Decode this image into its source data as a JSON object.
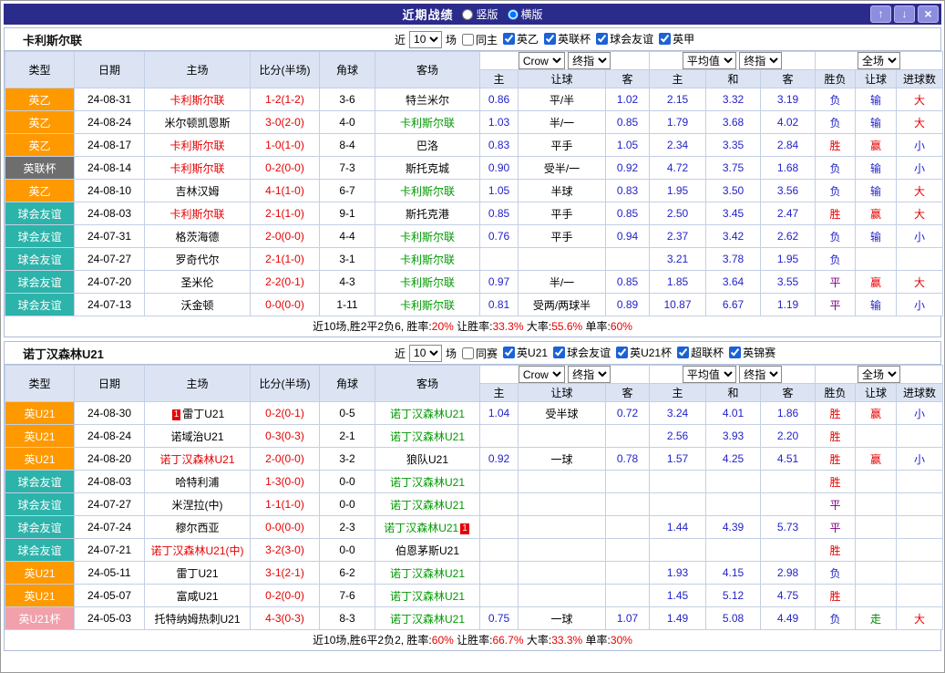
{
  "titlebar": {
    "title": "近期战绩",
    "radios": [
      {
        "label": "竖版",
        "checked": false
      },
      {
        "label": "横版",
        "checked": true
      }
    ],
    "buttons": {
      "up": "↑",
      "down": "↓",
      "close": "×"
    }
  },
  "filter_labels": {
    "near": "近",
    "games": "场"
  },
  "selects": {
    "crow": "Crow",
    "final": "终指",
    "average": "平均值",
    "fulltime": "全场"
  },
  "columns": {
    "type": "类型",
    "date": "日期",
    "home": "主场",
    "score": "比分(半场)",
    "corner": "角球",
    "away": "客场",
    "h": "主",
    "handicap": "让球",
    "a": "客",
    "avg_h": "主",
    "draw": "和",
    "avg_a": "客",
    "result": "胜负",
    "handicap_result": "让球",
    "goals": "进球数"
  },
  "colors": {
    "league_two": "#ff9900",
    "efl_cup": "#6e6e6e",
    "friendly": "#2cb3aa",
    "u21_cup": "#f0a1ac",
    "win": "#e60000",
    "lose": "#2323c8",
    "draw": "#800080",
    "push": "#008800"
  },
  "sections": [
    {
      "team": "卡利斯尔联",
      "filter": {
        "count": "10",
        "same": {
          "label": "同主",
          "checked": false
        },
        "leagues": [
          {
            "label": "英乙",
            "checked": true
          },
          {
            "label": "英联杯",
            "checked": true
          },
          {
            "label": "球会友谊",
            "checked": true
          },
          {
            "label": "英甲",
            "checked": true
          }
        ]
      },
      "rows": [
        {
          "type": {
            "t": "英乙",
            "bg": "#ff9900"
          },
          "date": "24-08-31",
          "home": {
            "t": "卡利斯尔联",
            "c": "red"
          },
          "score": "1-2(1-2)",
          "corner": "3-6",
          "away": {
            "t": "特兰米尔"
          },
          "o1": [
            "0.86",
            "平/半",
            "1.02"
          ],
          "o2": [
            "2.15",
            "3.32",
            "3.19"
          ],
          "res": [
            [
              "负",
              "lose"
            ],
            [
              "输",
              "lose"
            ],
            [
              "大",
              "win"
            ]
          ]
        },
        {
          "type": {
            "t": "英乙",
            "bg": "#ff9900"
          },
          "date": "24-08-24",
          "home": {
            "t": "米尔顿凯恩斯"
          },
          "score": "3-0(2-0)",
          "corner": "4-0",
          "away": {
            "t": "卡利斯尔联",
            "c": "green"
          },
          "o1": [
            "1.03",
            "半/一",
            "0.85"
          ],
          "o2": [
            "1.79",
            "3.68",
            "4.02"
          ],
          "res": [
            [
              "负",
              "lose"
            ],
            [
              "输",
              "lose"
            ],
            [
              "大",
              "win"
            ]
          ]
        },
        {
          "type": {
            "t": "英乙",
            "bg": "#ff9900"
          },
          "date": "24-08-17",
          "home": {
            "t": "卡利斯尔联",
            "c": "red"
          },
          "score": "1-0(1-0)",
          "corner": "8-4",
          "away": {
            "t": "巴洛"
          },
          "o1": [
            "0.83",
            "平手",
            "1.05"
          ],
          "o2": [
            "2.34",
            "3.35",
            "2.84"
          ],
          "res": [
            [
              "胜",
              "win"
            ],
            [
              "赢",
              "win"
            ],
            [
              "小",
              "lose"
            ]
          ]
        },
        {
          "type": {
            "t": "英联杯",
            "bg": "#6e6e6e"
          },
          "date": "24-08-14",
          "home": {
            "t": "卡利斯尔联",
            "c": "red"
          },
          "score": "0-2(0-0)",
          "corner": "7-3",
          "away": {
            "t": "斯托克城"
          },
          "o1": [
            "0.90",
            "受半/一",
            "0.92"
          ],
          "o2": [
            "4.72",
            "3.75",
            "1.68"
          ],
          "res": [
            [
              "负",
              "lose"
            ],
            [
              "输",
              "lose"
            ],
            [
              "小",
              "lose"
            ]
          ]
        },
        {
          "type": {
            "t": "英乙",
            "bg": "#ff9900"
          },
          "date": "24-08-10",
          "home": {
            "t": "吉林汉姆"
          },
          "score": "4-1(1-0)",
          "corner": "6-7",
          "away": {
            "t": "卡利斯尔联",
            "c": "green"
          },
          "o1": [
            "1.05",
            "半球",
            "0.83"
          ],
          "o2": [
            "1.95",
            "3.50",
            "3.56"
          ],
          "res": [
            [
              "负",
              "lose"
            ],
            [
              "输",
              "lose"
            ],
            [
              "大",
              "win"
            ]
          ]
        },
        {
          "type": {
            "t": "球会友谊",
            "bg": "#2cb3aa"
          },
          "date": "24-08-03",
          "home": {
            "t": "卡利斯尔联",
            "c": "red"
          },
          "score": "2-1(1-0)",
          "corner": "9-1",
          "away": {
            "t": "斯托克港"
          },
          "o1": [
            "0.85",
            "平手",
            "0.85"
          ],
          "o2": [
            "2.50",
            "3.45",
            "2.47"
          ],
          "res": [
            [
              "胜",
              "win"
            ],
            [
              "赢",
              "win"
            ],
            [
              "大",
              "win"
            ]
          ]
        },
        {
          "type": {
            "t": "球会友谊",
            "bg": "#2cb3aa"
          },
          "date": "24-07-31",
          "home": {
            "t": "格茨海德"
          },
          "score": "2-0(0-0)",
          "corner": "4-4",
          "away": {
            "t": "卡利斯尔联",
            "c": "green"
          },
          "o1": [
            "0.76",
            "平手",
            "0.94"
          ],
          "o2": [
            "2.37",
            "3.42",
            "2.62"
          ],
          "res": [
            [
              "负",
              "lose"
            ],
            [
              "输",
              "lose"
            ],
            [
              "小",
              "lose"
            ]
          ]
        },
        {
          "type": {
            "t": "球会友谊",
            "bg": "#2cb3aa"
          },
          "date": "24-07-27",
          "home": {
            "t": "罗奇代尔"
          },
          "score": "2-1(1-0)",
          "corner": "3-1",
          "away": {
            "t": "卡利斯尔联",
            "c": "green"
          },
          "o1": [
            "",
            "",
            ""
          ],
          "o2": [
            "3.21",
            "3.78",
            "1.95"
          ],
          "res": [
            [
              "负",
              "lose"
            ],
            [
              "",
              ""
            ],
            [
              "",
              ""
            ]
          ]
        },
        {
          "type": {
            "t": "球会友谊",
            "bg": "#2cb3aa"
          },
          "date": "24-07-20",
          "home": {
            "t": "圣米伦"
          },
          "score": "2-2(0-1)",
          "corner": "4-3",
          "away": {
            "t": "卡利斯尔联",
            "c": "green"
          },
          "o1": [
            "0.97",
            "半/一",
            "0.85"
          ],
          "o2": [
            "1.85",
            "3.64",
            "3.55"
          ],
          "res": [
            [
              "平",
              "draw"
            ],
            [
              "赢",
              "win"
            ],
            [
              "大",
              "win"
            ]
          ]
        },
        {
          "type": {
            "t": "球会友谊",
            "bg": "#2cb3aa"
          },
          "date": "24-07-13",
          "home": {
            "t": "沃金顿"
          },
          "score": "0-0(0-0)",
          "corner": "1-11",
          "away": {
            "t": "卡利斯尔联",
            "c": "green"
          },
          "o1": [
            "0.81",
            "受两/两球半",
            "0.89"
          ],
          "o2": [
            "10.87",
            "6.67",
            "1.19"
          ],
          "res": [
            [
              "平",
              "draw"
            ],
            [
              "输",
              "lose"
            ],
            [
              "小",
              "lose"
            ]
          ]
        }
      ],
      "summary": [
        {
          "t": "近10场,胜2平2负6, 胜率:"
        },
        {
          "t": "20%",
          "red": true
        },
        {
          "t": " 让胜率:"
        },
        {
          "t": "33.3%",
          "red": true
        },
        {
          "t": " 大率:"
        },
        {
          "t": "55.6%",
          "red": true
        },
        {
          "t": " 单率:"
        },
        {
          "t": "60%",
          "red": true
        }
      ]
    },
    {
      "team": "诺丁汉森林U21",
      "filter": {
        "count": "10",
        "same": {
          "label": "同赛",
          "checked": false
        },
        "leagues": [
          {
            "label": "英U21",
            "checked": true
          },
          {
            "label": "球会友谊",
            "checked": true
          },
          {
            "label": "英U21杯",
            "checked": true
          },
          {
            "label": "超联杯",
            "checked": true
          },
          {
            "label": "英锦赛",
            "checked": true
          }
        ]
      },
      "rows": [
        {
          "type": {
            "t": "英U21",
            "bg": "#ff9900"
          },
          "date": "24-08-30",
          "home": {
            "t": "雷丁U21",
            "rc": "1",
            "rcpos": "before"
          },
          "score": "0-2(0-1)",
          "corner": "0-5",
          "away": {
            "t": "诺丁汉森林U21",
            "c": "green"
          },
          "o1": [
            "1.04",
            "受半球",
            "0.72"
          ],
          "o2": [
            "3.24",
            "4.01",
            "1.86"
          ],
          "res": [
            [
              "胜",
              "win"
            ],
            [
              "赢",
              "win"
            ],
            [
              "小",
              "lose"
            ]
          ]
        },
        {
          "type": {
            "t": "英U21",
            "bg": "#ff9900"
          },
          "date": "24-08-24",
          "home": {
            "t": "诺域治U21"
          },
          "score": "0-3(0-3)",
          "corner": "2-1",
          "away": {
            "t": "诺丁汉森林U21",
            "c": "green"
          },
          "o1": [
            "",
            "",
            ""
          ],
          "o2": [
            "2.56",
            "3.93",
            "2.20"
          ],
          "res": [
            [
              "胜",
              "win"
            ],
            [
              "",
              ""
            ],
            [
              "",
              ""
            ]
          ]
        },
        {
          "type": {
            "t": "英U21",
            "bg": "#ff9900"
          },
          "date": "24-08-20",
          "home": {
            "t": "诺丁汉森林U21",
            "c": "red"
          },
          "score": "2-0(0-0)",
          "corner": "3-2",
          "away": {
            "t": "狼队U21"
          },
          "o1": [
            "0.92",
            "一球",
            "0.78"
          ],
          "o2": [
            "1.57",
            "4.25",
            "4.51"
          ],
          "res": [
            [
              "胜",
              "win"
            ],
            [
              "赢",
              "win"
            ],
            [
              "小",
              "lose"
            ]
          ]
        },
        {
          "type": {
            "t": "球会友谊",
            "bg": "#2cb3aa"
          },
          "date": "24-08-03",
          "home": {
            "t": "哈特利浦"
          },
          "score": "1-3(0-0)",
          "corner": "0-0",
          "away": {
            "t": "诺丁汉森林U21",
            "c": "green"
          },
          "o1": [
            "",
            "",
            ""
          ],
          "o2": [
            "",
            "",
            ""
          ],
          "res": [
            [
              "胜",
              "win"
            ],
            [
              "",
              ""
            ],
            [
              "",
              ""
            ]
          ]
        },
        {
          "type": {
            "t": "球会友谊",
            "bg": "#2cb3aa"
          },
          "date": "24-07-27",
          "home": {
            "t": "米涅拉(中)"
          },
          "score": "1-1(1-0)",
          "corner": "0-0",
          "away": {
            "t": "诺丁汉森林U21",
            "c": "green"
          },
          "o1": [
            "",
            "",
            ""
          ],
          "o2": [
            "",
            "",
            ""
          ],
          "res": [
            [
              "平",
              "draw"
            ],
            [
              "",
              ""
            ],
            [
              "",
              ""
            ]
          ]
        },
        {
          "type": {
            "t": "球会友谊",
            "bg": "#2cb3aa"
          },
          "date": "24-07-24",
          "home": {
            "t": "穆尔西亚"
          },
          "score": "0-0(0-0)",
          "corner": "2-3",
          "away": {
            "t": "诺丁汉森林U21",
            "c": "green",
            "rc": "1",
            "rcpos": "after"
          },
          "o1": [
            "",
            "",
            ""
          ],
          "o2": [
            "1.44",
            "4.39",
            "5.73"
          ],
          "res": [
            [
              "平",
              "draw"
            ],
            [
              "",
              ""
            ],
            [
              "",
              ""
            ]
          ]
        },
        {
          "type": {
            "t": "球会友谊",
            "bg": "#2cb3aa"
          },
          "date": "24-07-21",
          "home": {
            "t": "诺丁汉森林U21(中)",
            "c": "red"
          },
          "score": "3-2(3-0)",
          "corner": "0-0",
          "away": {
            "t": "伯恩茅斯U21"
          },
          "o1": [
            "",
            "",
            ""
          ],
          "o2": [
            "",
            "",
            ""
          ],
          "res": [
            [
              "胜",
              "win"
            ],
            [
              "",
              ""
            ],
            [
              "",
              ""
            ]
          ]
        },
        {
          "type": {
            "t": "英U21",
            "bg": "#ff9900"
          },
          "date": "24-05-11",
          "home": {
            "t": "雷丁U21"
          },
          "score": "3-1(2-1)",
          "corner": "6-2",
          "away": {
            "t": "诺丁汉森林U21",
            "c": "green"
          },
          "o1": [
            "",
            "",
            ""
          ],
          "o2": [
            "1.93",
            "4.15",
            "2.98"
          ],
          "res": [
            [
              "负",
              "lose"
            ],
            [
              "",
              ""
            ],
            [
              "",
              ""
            ]
          ]
        },
        {
          "type": {
            "t": "英U21",
            "bg": "#ff9900"
          },
          "date": "24-05-07",
          "home": {
            "t": "富咸U21"
          },
          "score": "0-2(0-0)",
          "corner": "7-6",
          "away": {
            "t": "诺丁汉森林U21",
            "c": "green"
          },
          "o1": [
            "",
            "",
            ""
          ],
          "o2": [
            "1.45",
            "5.12",
            "4.75"
          ],
          "res": [
            [
              "胜",
              "win"
            ],
            [
              "",
              ""
            ],
            [
              "",
              ""
            ]
          ]
        },
        {
          "type": {
            "t": "英U21杯",
            "bg": "#f0a1ac"
          },
          "date": "24-05-03",
          "home": {
            "t": "托特纳姆热刺U21"
          },
          "score": "4-3(0-3)",
          "corner": "8-3",
          "away": {
            "t": "诺丁汉森林U21",
            "c": "green"
          },
          "o1": [
            "0.75",
            "一球",
            "1.07"
          ],
          "o2": [
            "1.49",
            "5.08",
            "4.49"
          ],
          "res": [
            [
              "负",
              "lose"
            ],
            [
              "走",
              "push"
            ],
            [
              "大",
              "win"
            ]
          ]
        }
      ],
      "summary": [
        {
          "t": "近10场,胜6平2负2, 胜率:"
        },
        {
          "t": "60%",
          "red": true
        },
        {
          "t": " 让胜率:"
        },
        {
          "t": "66.7%",
          "red": true
        },
        {
          "t": " 大率:"
        },
        {
          "t": "33.3%",
          "red": true
        },
        {
          "t": " 单率:"
        },
        {
          "t": "30%",
          "red": true
        }
      ]
    }
  ]
}
